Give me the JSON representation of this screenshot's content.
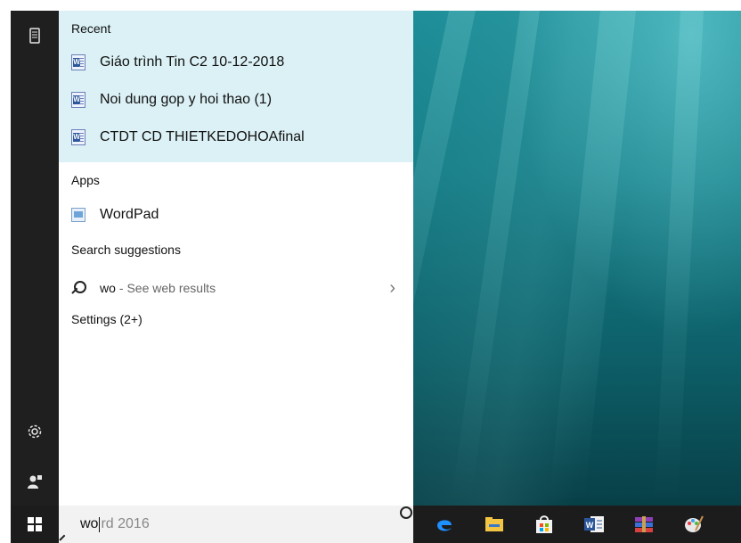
{
  "rail": {
    "icons": [
      "tablet-icon",
      "settings-gear-icon",
      "user-account-icon"
    ]
  },
  "recent": {
    "title": "Recent",
    "items": [
      {
        "label": "Giáo trình Tin C2 10-12-2018",
        "icon": "word-document-icon"
      },
      {
        "label": "Noi dung gop y hoi thao (1)",
        "icon": "word-document-icon"
      },
      {
        "label": "CTDT CD THIETKEDOHOAfinal",
        "icon": "word-document-icon"
      }
    ]
  },
  "apps": {
    "title": "Apps",
    "items": [
      {
        "label": "WordPad",
        "icon": "wordpad-icon"
      }
    ]
  },
  "suggestions": {
    "title": "Search suggestions",
    "term": "wo",
    "subtitle": "- See web results"
  },
  "settings": {
    "title": "Settings (2+)"
  },
  "search": {
    "typed": "wo",
    "hint": "rd 2016"
  },
  "taskbar": {
    "apps": [
      "edge-icon",
      "file-explorer-icon",
      "store-icon",
      "word-icon",
      "winrar-icon",
      "paint-icon"
    ]
  },
  "colors": {
    "recent_bg": "#dbf1f5",
    "rail_bg": "#1f1f1f",
    "taskbar_bg": "#1c1c1c",
    "search_bg": "#f2f2f2"
  }
}
